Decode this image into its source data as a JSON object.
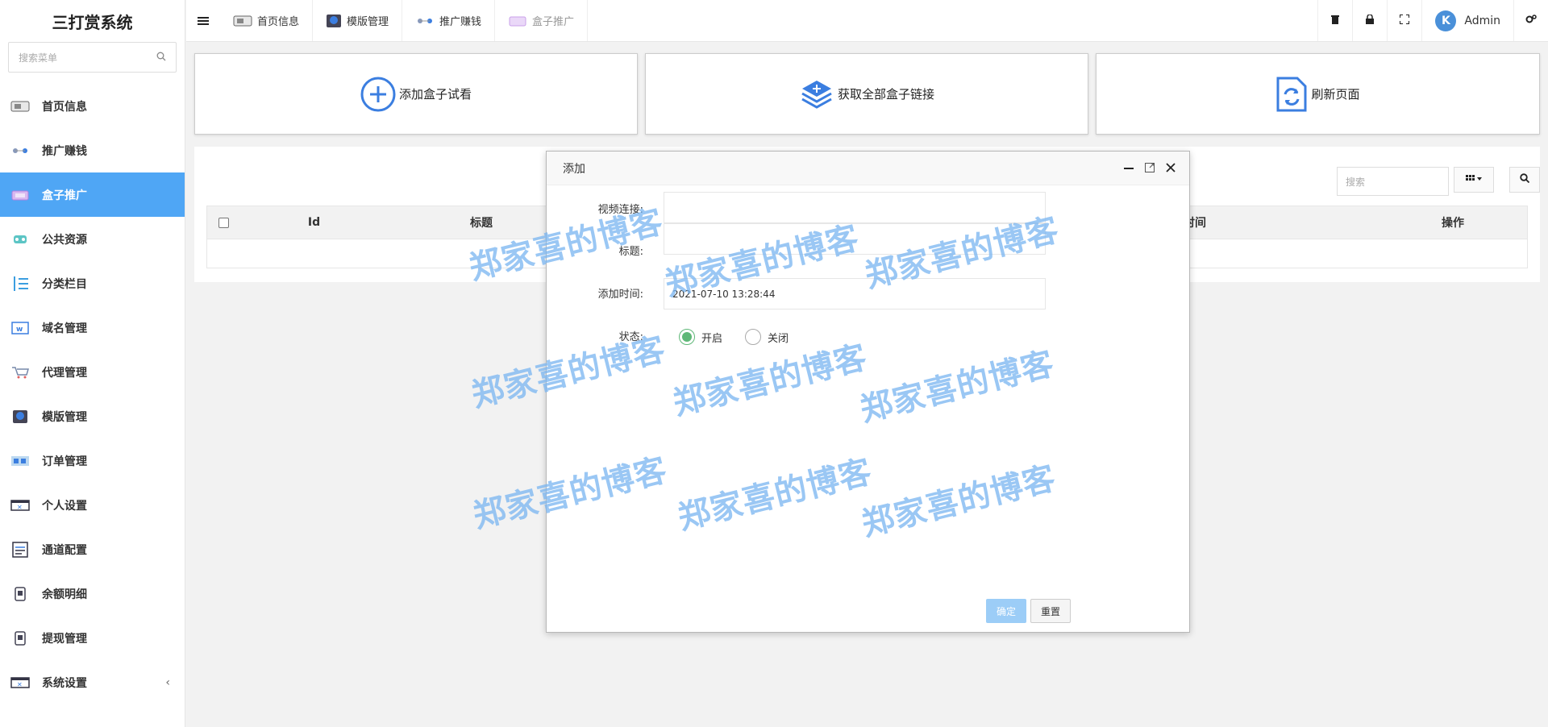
{
  "app": {
    "title": "三打赏系统"
  },
  "sidebar": {
    "search_placeholder": "搜索菜单",
    "items": [
      {
        "label": "首页信息",
        "icon": "dashboard-icon"
      },
      {
        "label": "推广赚钱",
        "icon": "promote-icon"
      },
      {
        "label": "盒子推广",
        "icon": "box-icon",
        "active": true
      },
      {
        "label": "公共资源",
        "icon": "resource-icon"
      },
      {
        "label": "分类栏目",
        "icon": "category-icon"
      },
      {
        "label": "域名管理",
        "icon": "domain-icon"
      },
      {
        "label": "代理管理",
        "icon": "agent-icon"
      },
      {
        "label": "模版管理",
        "icon": "template-icon"
      },
      {
        "label": "订单管理",
        "icon": "order-icon"
      },
      {
        "label": "个人设置",
        "icon": "profile-icon"
      },
      {
        "label": "通道配置",
        "icon": "channel-icon"
      },
      {
        "label": "余额明细",
        "icon": "balance-icon"
      },
      {
        "label": "提现管理",
        "icon": "withdraw-icon"
      },
      {
        "label": "系统设置",
        "icon": "settings-icon"
      }
    ]
  },
  "topbar": {
    "tabs": [
      "首页信息",
      "模版管理",
      "推广赚钱",
      "盒子推广"
    ],
    "user": "Admin"
  },
  "actions": {
    "add_box": "添加盒子试看",
    "get_links": "获取全部盒子链接",
    "refresh": "刷新页面"
  },
  "table": {
    "search_placeholder": "搜索",
    "columns": [
      "Id",
      "标题",
      "时间",
      "操作"
    ]
  },
  "modal": {
    "title": "添加",
    "fields": {
      "video_label": "视频连接:",
      "title_label": "标题:",
      "time_label": "添加时间:",
      "time_value": "2021-07-10 13:28:44",
      "status_label": "状态:"
    },
    "status_options": [
      "开启",
      "关闭"
    ],
    "selected_status": "开启",
    "ok": "确定",
    "reset": "重置"
  },
  "watermark": "郑家喜的博客",
  "colors": {
    "accent": "#4fa6f5",
    "radio_on": "#5fb878",
    "confirm": "#9ccdf7",
    "icon_blue": "#3b7ee0"
  }
}
